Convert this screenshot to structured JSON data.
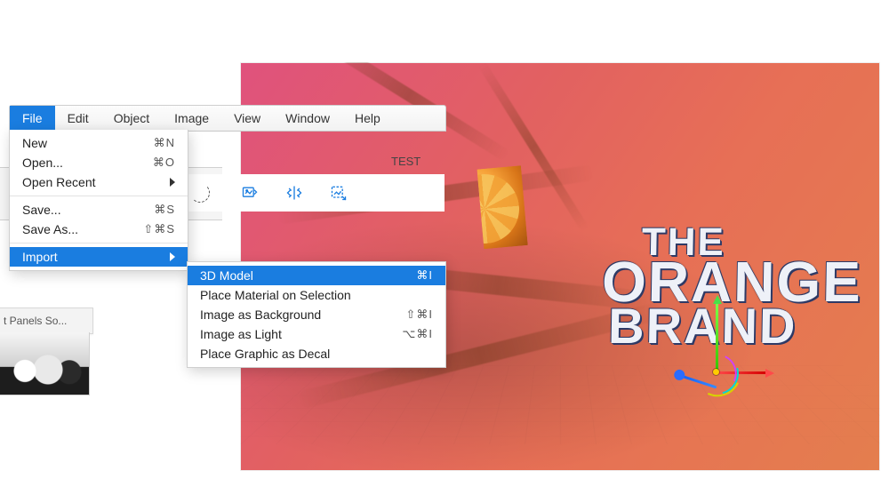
{
  "menubar": {
    "items": [
      "File",
      "Edit",
      "Object",
      "Image",
      "View",
      "Window",
      "Help"
    ],
    "active_index": 0
  },
  "file_menu": {
    "new": {
      "label": "New",
      "shortcut": "⌘N"
    },
    "open": {
      "label": "Open...",
      "shortcut": "⌘O"
    },
    "open_recent": {
      "label": "Open Recent"
    },
    "save": {
      "label": "Save...",
      "shortcut": "⌘S"
    },
    "save_as": {
      "label": "Save As...",
      "shortcut": "⇧⌘S"
    },
    "import": {
      "label": "Import"
    }
  },
  "import_submenu": {
    "model": {
      "label": "3D Model",
      "shortcut": "⌘I"
    },
    "place_material": {
      "label": "Place Material on Selection"
    },
    "image_bg": {
      "label": "Image as Background",
      "shortcut": "⇧⌘I"
    },
    "image_light": {
      "label": "Image as Light",
      "shortcut": "⌥⌘I"
    },
    "decal": {
      "label": "Place Graphic as Decal"
    }
  },
  "toolbar": {
    "test_label": "TEST",
    "icons": [
      "image-fit-icon",
      "symmetry-icon",
      "decal-place-icon"
    ]
  },
  "panel": {
    "tab_label_truncated": "t Panels So..."
  },
  "scene": {
    "logo_line1": "THE",
    "logo_line2": "ORANGE",
    "logo_line3": "BRAND"
  }
}
